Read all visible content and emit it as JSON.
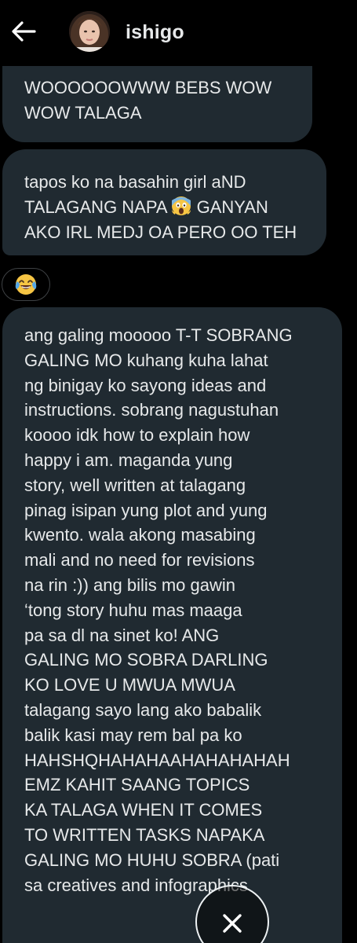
{
  "header": {
    "username": "ishigo",
    "back_icon": "arrow-left-icon",
    "avatar_icon": "avatar-photo"
  },
  "messages": [
    {
      "lines": [
        "WOOOOOOWWW BEBS WOW",
        "WOW TALAGA"
      ]
    },
    {
      "lines_before_emoji": [
        "tapos ko na basahin girl aND"
      ],
      "line_with_emoji_before": "TALAGANG NAPA ",
      "emoji": "face-screaming-in-fear",
      "line_with_emoji_after": " GANYAN",
      "lines_after_emoji": [
        "AKO IRL MEDJ OA PERO OO TEH"
      ]
    },
    {
      "lines": [
        "ang galing mooooo T-T SOBRANG",
        "GALING MO kuhang kuha lahat",
        "ng binigay ko sayong ideas and",
        "instructions. sobrang nagustuhan",
        "koooo idk how to explain how",
        "happy i am. maganda yung",
        "story, well written at talagang",
        "pinag isipan yung plot and yung",
        "kwento. wala akong masabing",
        "mali and no need for revisions",
        "na rin :)) ang bilis mo gawin",
        "‘tong story huhu mas maaga",
        "pa sa dl na sinet ko! ANG",
        "GALING MO SOBRA DARLING",
        "KO LOVE U MWUA MWUA",
        "talagang sayo lang ako babalik",
        "balik kasi may rem bal pa ko",
        "HAHSHQHAHAHAAHAHAHAHAH",
        "EMZ KAHIT SAANG TOPICS",
        "KA TALAGA WHEN IT COMES",
        "TO WRITTEN TASKS NAPAKA",
        "GALING MO HUHU SOBRA (pati",
        "sa creatives and infographics"
      ]
    }
  ],
  "reaction": {
    "emoji": "face-with-tears-of-joy"
  },
  "overlay": {
    "close_icon": "close-icon"
  },
  "colors": {
    "background": "#000000",
    "bubble": "#202a31",
    "text": "#e7e9ea",
    "reaction_border": "#3e4144"
  }
}
